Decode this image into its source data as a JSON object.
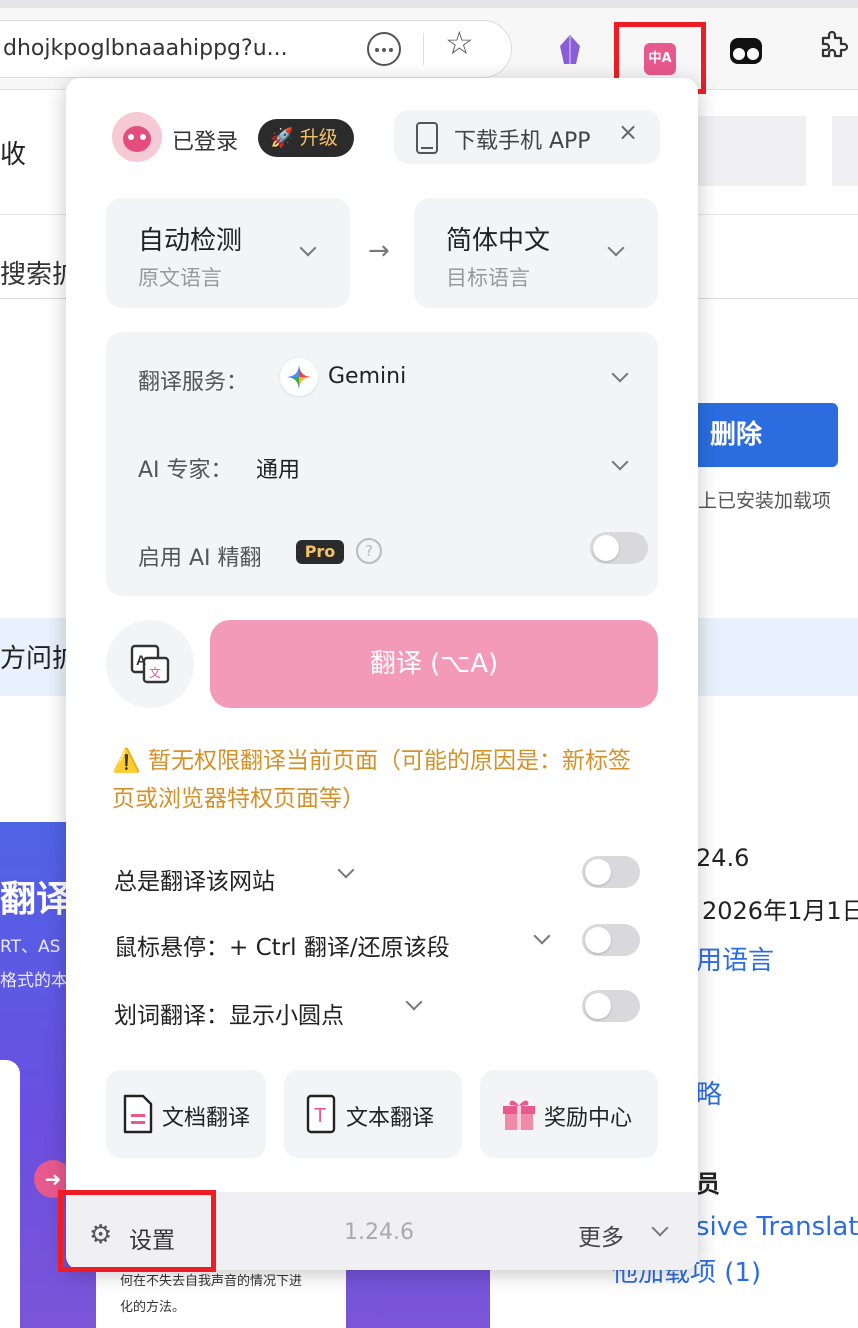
{
  "browser": {
    "url": "dhojkpoglbnaaahippg?u..."
  },
  "background_page": {
    "heading_fragment": "收",
    "search_fragment": "搜索扩",
    "delete_button": "删除",
    "installed_text": "上已安装加载项",
    "access_fragment": "方问扩",
    "promo_title_fragment": "翻译-",
    "promo_sub1": "RT、AS",
    "promo_sub2": "格式的本",
    "promo_card_line1": "何在不失去自我声音的情况下进",
    "promo_card_line2": "化的方法。",
    "version_fragment": "24.6",
    "date_fragment": "2026年1月1日",
    "lang_link_fragment": "用语言",
    "policy_fragment": "略",
    "member_fragment": "员",
    "immersive_fragment": "sive Translate",
    "addons_fragment": "他加载项 (1)"
  },
  "popup": {
    "header": {
      "login_status": "已登录",
      "upgrade_label": "升级",
      "download_label": "下载手机 APP",
      "close_glyph": "×"
    },
    "source_lang": {
      "value": "自动检测",
      "caption": "原文语言"
    },
    "target_lang": {
      "value": "简体中文",
      "caption": "目标语言"
    },
    "arrow_glyph": "→",
    "service": {
      "label": "翻译服务：",
      "value": "Gemini",
      "expert_label": "AI 专家：",
      "expert_value": "通用",
      "refine_label": "启用 AI 精翻",
      "pro_badge": "Pro",
      "help_glyph": "?",
      "refine_enabled": false
    },
    "translate_button": "翻译 (⌥A)",
    "warning": "⚠️ 暂无权限翻译当前页面（可能的原因是：新标签页或浏览器特权页面等）",
    "options": [
      {
        "label": "总是翻译该网站",
        "enabled": false
      },
      {
        "label": "鼠标悬停：+ Ctrl 翻译/还原该段",
        "enabled": false
      },
      {
        "label": "划词翻译：显示小圆点",
        "enabled": false
      }
    ],
    "tools": [
      {
        "label": "文档翻译",
        "icon": "document-icon"
      },
      {
        "label": "文本翻译",
        "icon": "text-icon"
      },
      {
        "label": "奖励中心",
        "icon": "gift-icon"
      }
    ],
    "footer": {
      "settings_label": "设置",
      "version": "1.24.6",
      "more_label": "更多"
    }
  },
  "colors": {
    "accent_pink": "#f39ab8",
    "warning_orange": "#d4912a",
    "highlight_red": "#ee1c24",
    "link_blue": "#2b6de0"
  }
}
